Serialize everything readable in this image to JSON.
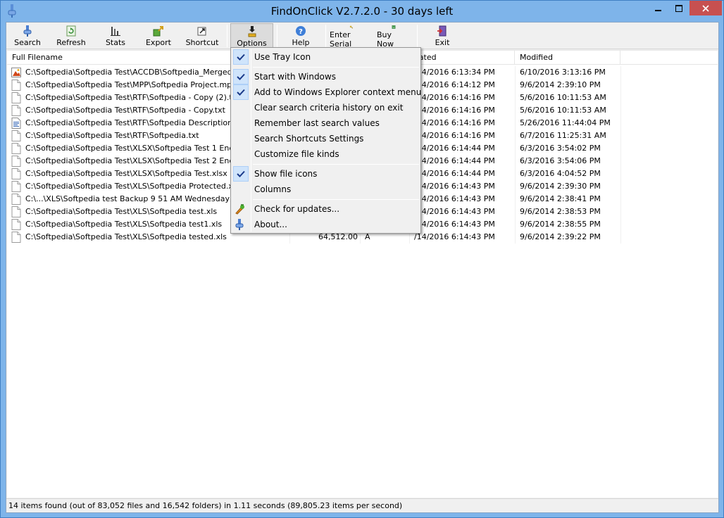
{
  "window": {
    "title": "FindOnClick V2.7.2.0 - 30 days left",
    "minimize": "–",
    "maximize": "□",
    "close": "✕"
  },
  "toolbar": {
    "search": "Search",
    "refresh": "Refresh",
    "stats": "Stats",
    "export": "Export",
    "shortcut": "Shortcut",
    "options": "Options",
    "help": "Help",
    "enter_serial": "Enter Serial",
    "buy_now": "Buy Now",
    "exit": "Exit"
  },
  "columns": {
    "name": "Full Filename",
    "size": "",
    "attr": "",
    "created": "eated",
    "modified": "Modified"
  },
  "rows": [
    {
      "name": "C:\\Softpedia\\Softpedia Test\\ACCDB\\Softpedia_Merged.tif",
      "size": "",
      "attr": "",
      "created": "/14/2016 6:13:34 PM",
      "modified": "6/10/2016 3:13:16 PM",
      "icon": "image"
    },
    {
      "name": "C:\\Softpedia\\Softpedia Test\\MPP\\Softpedia Project.mpp",
      "size": "",
      "attr": "",
      "created": "/14/2016 6:14:12 PM",
      "modified": "9/6/2014 2:39:10 PM",
      "icon": "doc"
    },
    {
      "name": "C:\\Softpedia\\Softpedia Test\\RTF\\Softpedia - Copy (2).txt",
      "size": "",
      "attr": "",
      "created": "/14/2016 6:14:16 PM",
      "modified": "5/6/2016 10:11:53 AM",
      "icon": "doc"
    },
    {
      "name": "C:\\Softpedia\\Softpedia Test\\RTF\\Softpedia - Copy.txt",
      "size": "",
      "attr": "",
      "created": "/14/2016 6:14:16 PM",
      "modified": "5/6/2016 10:11:53 AM",
      "icon": "doc"
    },
    {
      "name": "C:\\Softpedia\\Softpedia Test\\RTF\\Softpedia Description.rtf",
      "size": "",
      "attr": "",
      "created": "/14/2016 6:14:16 PM",
      "modified": "5/26/2016 11:44:04 PM",
      "icon": "rtf"
    },
    {
      "name": "C:\\Softpedia\\Softpedia Test\\RTF\\Softpedia.txt",
      "size": "",
      "attr": "",
      "created": "/14/2016 6:14:16 PM",
      "modified": "6/7/2016 11:25:31 AM",
      "icon": "doc"
    },
    {
      "name": "C:\\Softpedia\\Softpedia Test\\XLSX\\Softpedia Test 1 Encrypte",
      "size": "",
      "attr": "",
      "created": "/14/2016 6:14:44 PM",
      "modified": "6/3/2016 3:54:02 PM",
      "icon": "doc"
    },
    {
      "name": "C:\\Softpedia\\Softpedia Test\\XLSX\\Softpedia Test 2 Encrypte",
      "size": "",
      "attr": "",
      "created": "/14/2016 6:14:44 PM",
      "modified": "6/3/2016 3:54:06 PM",
      "icon": "doc"
    },
    {
      "name": "C:\\Softpedia\\Softpedia Test\\XLSX\\Softpedia Test.xlsx",
      "size": "",
      "attr": "",
      "created": "/14/2016 6:14:44 PM",
      "modified": "6/3/2016 4:04:52 PM",
      "icon": "doc"
    },
    {
      "name": "C:\\Softpedia\\Softpedia Test\\XLS\\Softpedia Protected.xls",
      "size": "",
      "attr": "",
      "created": "/14/2016 6:14:43 PM",
      "modified": "9/6/2014 2:39:30 PM",
      "icon": "doc"
    },
    {
      "name": "C:\\...\\XLS\\Softpedia test Backup 9 51 AM Wednesday, Aug",
      "size": "",
      "attr": "",
      "created": "/14/2016 6:14:43 PM",
      "modified": "9/6/2014 2:38:41 PM",
      "icon": "doc"
    },
    {
      "name": "C:\\Softpedia\\Softpedia Test\\XLS\\Softpedia test.xls",
      "size": "",
      "attr": "",
      "created": "/14/2016 6:14:43 PM",
      "modified": "9/6/2014 2:38:53 PM",
      "icon": "doc"
    },
    {
      "name": "C:\\Softpedia\\Softpedia Test\\XLS\\Softpedia test1.xls",
      "size": "",
      "attr": "",
      "created": "/14/2016 6:14:43 PM",
      "modified": "9/6/2014 2:38:55 PM",
      "icon": "doc"
    },
    {
      "name": "C:\\Softpedia\\Softpedia Test\\XLS\\Softpedia tested.xls",
      "size": "64,512.00",
      "attr": "A",
      "created": "/14/2016 6:14:43 PM",
      "modified": "9/6/2014 2:39:22 PM",
      "icon": "doc"
    }
  ],
  "menu": {
    "use_tray_icon": "Use Tray Icon",
    "start_with_windows": "Start with Windows",
    "add_to_explorer": "Add to Windows Explorer context menu",
    "clear_history": "Clear search criteria history on exit",
    "remember_last": "Remember last search values",
    "search_shortcuts": "Search Shortcuts Settings",
    "customize_kinds": "Customize file kinds",
    "show_file_icons": "Show file icons",
    "columns": "Columns",
    "check_updates": "Check for updates...",
    "about": "About..."
  },
  "status": {
    "text": "14 items found (out of 83,052 files and 16,542 folders) in 1.11 seconds (89,805.23 items per second)"
  },
  "colors": {
    "titlebar": "#7eb4ea",
    "close": "#c75050",
    "menu_check_bg": "#cfe4fb"
  }
}
